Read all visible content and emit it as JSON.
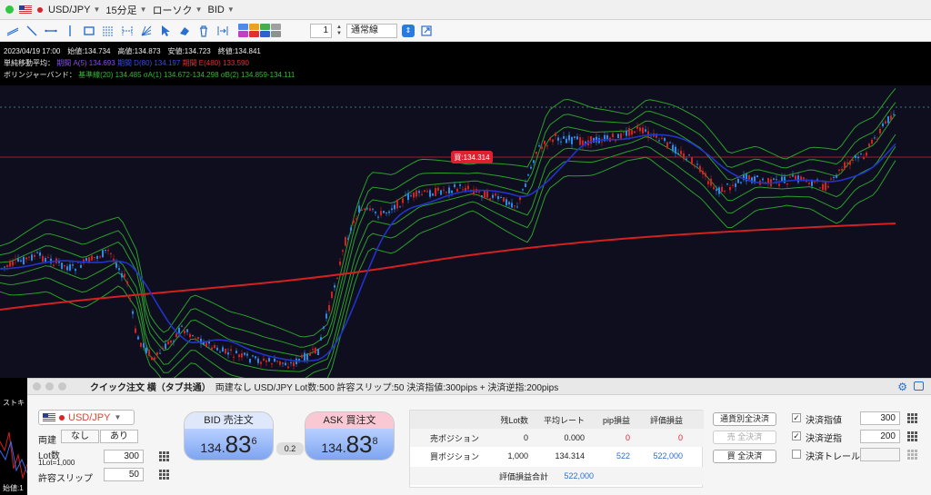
{
  "topbar": {
    "symbol": "USD/JPY",
    "timeframe": "15分足",
    "chart_type": "ローソク",
    "price_side": "BID"
  },
  "toolbar": {
    "line_width": "1",
    "line_style": "通常線",
    "palette": [
      "#4a8ae8",
      "#f0a020",
      "#40b050",
      "#a0a0a0",
      "#c040c0",
      "#e03030",
      "#3060d0",
      "#909090"
    ]
  },
  "chart": {
    "info_line1": "2023/04/19 17:00　始値:134.734　高値:134.873　安値:134.723　終値:134.841",
    "ma_label": "単純移動平均：",
    "ma_a": "期間 A(5) 134.693",
    "ma_b": "期間 D(80) 134.197",
    "ma_c": "期間 E(480) 133.590",
    "bb_label": "ボリンジャーバンド：",
    "bb_values": "基準線(20) 134.485  σA(1) 134.672-134.298  σB(2) 134.859-134.111",
    "buy_label": "買:134.314",
    "colors": {
      "ma_short": "#7a3ad8",
      "ma_mid": "#2233cc",
      "ma_long": "#d42020",
      "bb": "#2aa02a",
      "buy_line": "#e02030"
    }
  },
  "sidestrip": {
    "label": "ストキ",
    "footer": "始値:1"
  },
  "panel": {
    "title": "クイック注文 横（タブ共通）",
    "subtitle": "両建なし USD/JPY Lot数:500 許容スリップ:50 決済指値:300pips + 決済逆指:200pips",
    "pair": "USD/JPY",
    "hedge_label": "両建",
    "hedge_off": "なし",
    "hedge_on": "あり",
    "lot_label": "Lot数",
    "lot_note": "1Lot=1,000",
    "lot_value": "300",
    "slip_label": "許容スリップ",
    "slip_value": "50",
    "bid": {
      "label": "BID 売注文",
      "small": "134.",
      "big": "83",
      "sup": "6"
    },
    "ask": {
      "label": "ASK 買注文",
      "small": "134.",
      "big": "83",
      "sup": "8"
    },
    "spread": "0.2",
    "table": {
      "headers": [
        "残Lot数",
        "平均レート",
        "pip損益",
        "評価損益"
      ],
      "sell_label": "売ポジション",
      "sell": [
        "0",
        "0.000",
        "0",
        "0"
      ],
      "buy_label": "買ポジション",
      "buy": [
        "1,000",
        "134.314",
        "522",
        "522,000"
      ],
      "total_label": "評価損益合計",
      "total_value": "522,000"
    },
    "btn_close_all_pair": "通貨別全決済",
    "btn_sell_close": "売 全決済",
    "btn_buy_close": "買 全決済",
    "limit_label": "決済指値",
    "limit_value": "300",
    "stop_label": "決済逆指",
    "stop_value": "200",
    "trail_label": "決済トレール"
  }
}
